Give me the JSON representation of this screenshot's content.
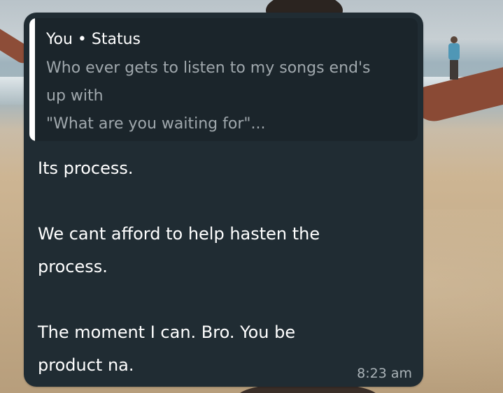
{
  "quote": {
    "author": "You • Status",
    "lines": [
      "Who ever gets to listen to my songs end's",
      "up with",
      "\"What are you waiting for\"..."
    ]
  },
  "message": {
    "lines": [
      "Its process.",
      "",
      "We cant afford to help hasten the",
      "process.",
      "",
      "The moment I can.  Bro. You be",
      "product na."
    ],
    "timestamp": "8:23 am"
  },
  "colors": {
    "bubble": "#202c33",
    "quote_bg": "#1b252b",
    "quote_bar": "#ffffff",
    "quote_text": "#a0a8ad",
    "timestamp": "#aab3b8"
  }
}
